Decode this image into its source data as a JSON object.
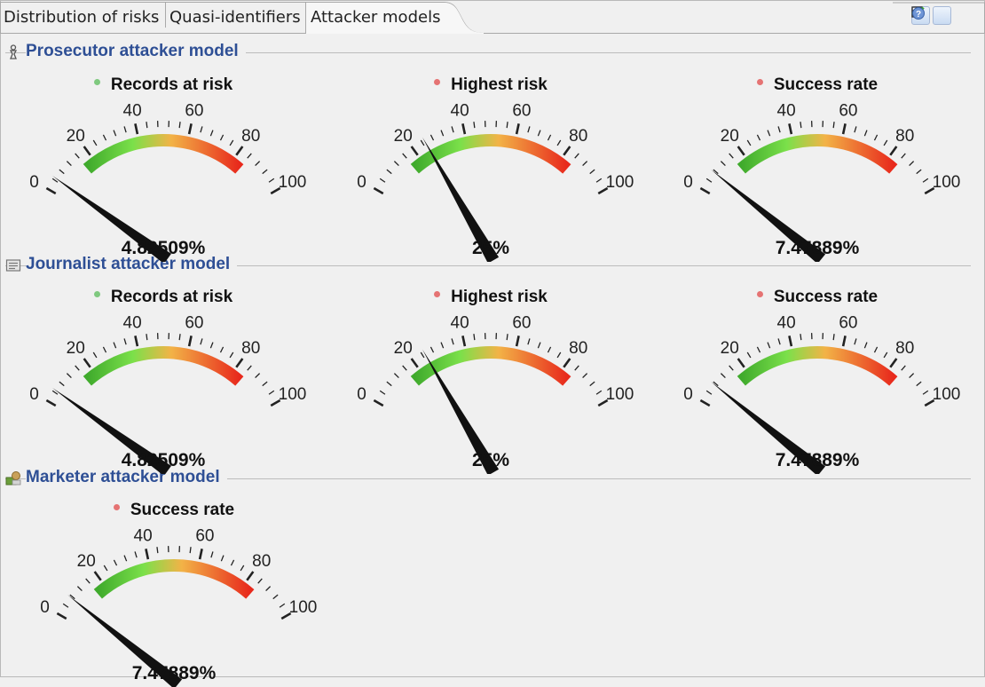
{
  "tabs": [
    {
      "label": "Distribution of risks",
      "active": false
    },
    {
      "label": "Quasi-identifiers",
      "active": false
    },
    {
      "label": "Attacker models",
      "active": true
    }
  ],
  "toolbar": {
    "icons": [
      "table-icon",
      "checkmark-icon",
      "help-icon"
    ]
  },
  "colors": {
    "section_title": "#2e4f95",
    "dot_green": "#7fc97f",
    "dot_red": "#e57373",
    "gauge_low": "#3faa2c",
    "gauge_mid": "#f2b347",
    "gauge_high": "#e8291c"
  },
  "scale": {
    "min": 0,
    "max": 100,
    "labels": [
      "0",
      "20",
      "40",
      "60",
      "80",
      "100"
    ]
  },
  "sections": [
    {
      "title": "Prosecutor attacker model",
      "icon": "prosecutor-icon",
      "gauges": [
        {
          "title": "Records at risk",
          "dot": "green",
          "value": 4.82509,
          "display": "4.82509%"
        },
        {
          "title": "Highest risk",
          "dot": "red",
          "value": 25,
          "display": "25%"
        },
        {
          "title": "Success rate",
          "dot": "red",
          "value": 7.47889,
          "display": "7.47889%"
        }
      ]
    },
    {
      "title": "Journalist attacker model",
      "icon": "journalist-icon",
      "gauges": [
        {
          "title": "Records at risk",
          "dot": "green",
          "value": 4.82509,
          "display": "4.82509%"
        },
        {
          "title": "Highest risk",
          "dot": "red",
          "value": 25,
          "display": "25%"
        },
        {
          "title": "Success rate",
          "dot": "red",
          "value": 7.47889,
          "display": "7.47889%"
        }
      ]
    },
    {
      "title": "Marketer attacker model",
      "icon": "marketer-icon",
      "gauges": [
        {
          "title": "Success rate",
          "dot": "red",
          "value": 7.47889,
          "display": "7.47889%"
        }
      ]
    }
  ]
}
